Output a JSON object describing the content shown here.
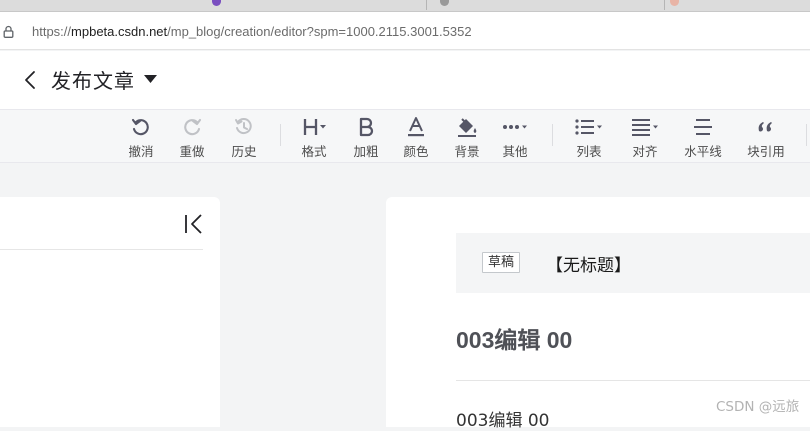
{
  "browser": {
    "url_prefix": "https://",
    "url_domain": "mpbeta.csdn.net",
    "url_path": "/mp_blog/creation/editor?spm=1000.2115.3001.5352"
  },
  "header": {
    "title": "发布文章"
  },
  "toolbar": {
    "undo": "撤消",
    "redo": "重做",
    "history": "历史",
    "format": "格式",
    "bold": "加粗",
    "color": "颜色",
    "background": "背景",
    "more": "其他",
    "list": "列表",
    "align": "对齐",
    "hr": "水平线",
    "quote": "块引用"
  },
  "editor": {
    "badge": "草稿",
    "doc_title": "【无标题】",
    "heading": "003编辑 00",
    "body": "003编辑 00"
  },
  "watermark": "CSDN @远旅",
  "colors": {
    "icon": "#555666",
    "icon_disabled": "#c0c2c6",
    "toolbar_bg": "#f6f7f8",
    "page_bg": "#f3f4f5"
  }
}
